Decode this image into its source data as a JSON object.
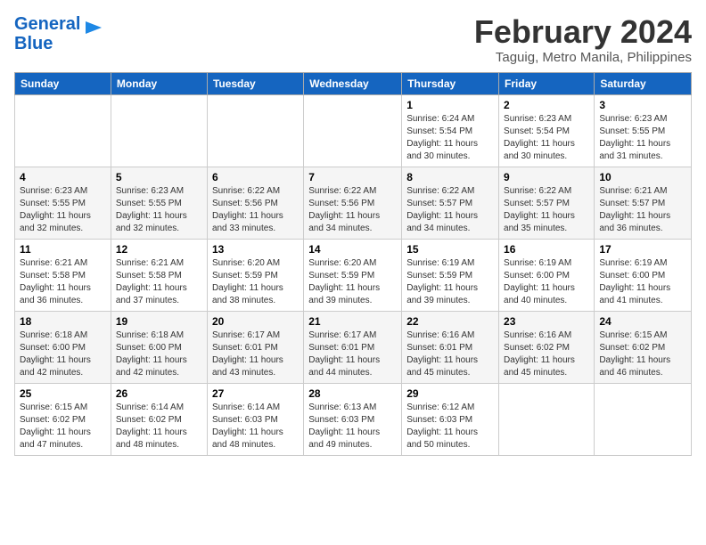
{
  "logo": {
    "line1": "General",
    "line2": "Blue"
  },
  "title": "February 2024",
  "location": "Taguig, Metro Manila, Philippines",
  "days_of_week": [
    "Sunday",
    "Monday",
    "Tuesday",
    "Wednesday",
    "Thursday",
    "Friday",
    "Saturday"
  ],
  "weeks": [
    [
      {
        "day": "",
        "info": ""
      },
      {
        "day": "",
        "info": ""
      },
      {
        "day": "",
        "info": ""
      },
      {
        "day": "",
        "info": ""
      },
      {
        "day": "1",
        "info": "Sunrise: 6:24 AM\nSunset: 5:54 PM\nDaylight: 11 hours and 30 minutes."
      },
      {
        "day": "2",
        "info": "Sunrise: 6:23 AM\nSunset: 5:54 PM\nDaylight: 11 hours and 30 minutes."
      },
      {
        "day": "3",
        "info": "Sunrise: 6:23 AM\nSunset: 5:55 PM\nDaylight: 11 hours and 31 minutes."
      }
    ],
    [
      {
        "day": "4",
        "info": "Sunrise: 6:23 AM\nSunset: 5:55 PM\nDaylight: 11 hours and 32 minutes."
      },
      {
        "day": "5",
        "info": "Sunrise: 6:23 AM\nSunset: 5:55 PM\nDaylight: 11 hours and 32 minutes."
      },
      {
        "day": "6",
        "info": "Sunrise: 6:22 AM\nSunset: 5:56 PM\nDaylight: 11 hours and 33 minutes."
      },
      {
        "day": "7",
        "info": "Sunrise: 6:22 AM\nSunset: 5:56 PM\nDaylight: 11 hours and 34 minutes."
      },
      {
        "day": "8",
        "info": "Sunrise: 6:22 AM\nSunset: 5:57 PM\nDaylight: 11 hours and 34 minutes."
      },
      {
        "day": "9",
        "info": "Sunrise: 6:22 AM\nSunset: 5:57 PM\nDaylight: 11 hours and 35 minutes."
      },
      {
        "day": "10",
        "info": "Sunrise: 6:21 AM\nSunset: 5:57 PM\nDaylight: 11 hours and 36 minutes."
      }
    ],
    [
      {
        "day": "11",
        "info": "Sunrise: 6:21 AM\nSunset: 5:58 PM\nDaylight: 11 hours and 36 minutes."
      },
      {
        "day": "12",
        "info": "Sunrise: 6:21 AM\nSunset: 5:58 PM\nDaylight: 11 hours and 37 minutes."
      },
      {
        "day": "13",
        "info": "Sunrise: 6:20 AM\nSunset: 5:59 PM\nDaylight: 11 hours and 38 minutes."
      },
      {
        "day": "14",
        "info": "Sunrise: 6:20 AM\nSunset: 5:59 PM\nDaylight: 11 hours and 39 minutes."
      },
      {
        "day": "15",
        "info": "Sunrise: 6:19 AM\nSunset: 5:59 PM\nDaylight: 11 hours and 39 minutes."
      },
      {
        "day": "16",
        "info": "Sunrise: 6:19 AM\nSunset: 6:00 PM\nDaylight: 11 hours and 40 minutes."
      },
      {
        "day": "17",
        "info": "Sunrise: 6:19 AM\nSunset: 6:00 PM\nDaylight: 11 hours and 41 minutes."
      }
    ],
    [
      {
        "day": "18",
        "info": "Sunrise: 6:18 AM\nSunset: 6:00 PM\nDaylight: 11 hours and 42 minutes."
      },
      {
        "day": "19",
        "info": "Sunrise: 6:18 AM\nSunset: 6:00 PM\nDaylight: 11 hours and 42 minutes."
      },
      {
        "day": "20",
        "info": "Sunrise: 6:17 AM\nSunset: 6:01 PM\nDaylight: 11 hours and 43 minutes."
      },
      {
        "day": "21",
        "info": "Sunrise: 6:17 AM\nSunset: 6:01 PM\nDaylight: 11 hours and 44 minutes."
      },
      {
        "day": "22",
        "info": "Sunrise: 6:16 AM\nSunset: 6:01 PM\nDaylight: 11 hours and 45 minutes."
      },
      {
        "day": "23",
        "info": "Sunrise: 6:16 AM\nSunset: 6:02 PM\nDaylight: 11 hours and 45 minutes."
      },
      {
        "day": "24",
        "info": "Sunrise: 6:15 AM\nSunset: 6:02 PM\nDaylight: 11 hours and 46 minutes."
      }
    ],
    [
      {
        "day": "25",
        "info": "Sunrise: 6:15 AM\nSunset: 6:02 PM\nDaylight: 11 hours and 47 minutes."
      },
      {
        "day": "26",
        "info": "Sunrise: 6:14 AM\nSunset: 6:02 PM\nDaylight: 11 hours and 48 minutes."
      },
      {
        "day": "27",
        "info": "Sunrise: 6:14 AM\nSunset: 6:03 PM\nDaylight: 11 hours and 48 minutes."
      },
      {
        "day": "28",
        "info": "Sunrise: 6:13 AM\nSunset: 6:03 PM\nDaylight: 11 hours and 49 minutes."
      },
      {
        "day": "29",
        "info": "Sunrise: 6:12 AM\nSunset: 6:03 PM\nDaylight: 11 hours and 50 minutes."
      },
      {
        "day": "",
        "info": ""
      },
      {
        "day": "",
        "info": ""
      }
    ]
  ]
}
